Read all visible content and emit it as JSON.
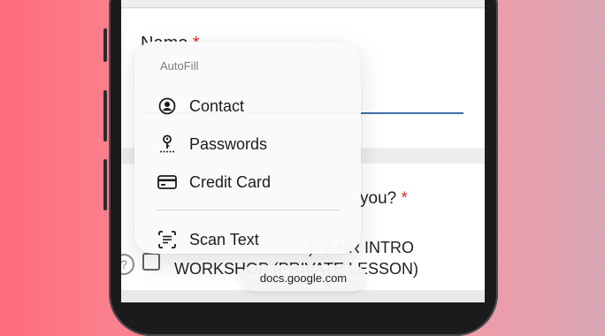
{
  "form": {
    "name_label": "Name",
    "required_mark": "*",
    "question_visible": "you?",
    "option_line1": "): 2-HR INTRO",
    "option_line2": "WORKSHOP (PRIVATE LESSON)",
    "help_glyph": "?"
  },
  "autofill": {
    "title": "AutoFill",
    "items": [
      {
        "label": "Contact",
        "icon": "contact-icon"
      },
      {
        "label": "Passwords",
        "icon": "key-icon"
      },
      {
        "label": "Credit Card",
        "icon": "credit-card-icon"
      },
      {
        "label": "Scan Text",
        "icon": "scan-text-icon"
      }
    ]
  },
  "browser": {
    "url": "docs.google.com"
  }
}
